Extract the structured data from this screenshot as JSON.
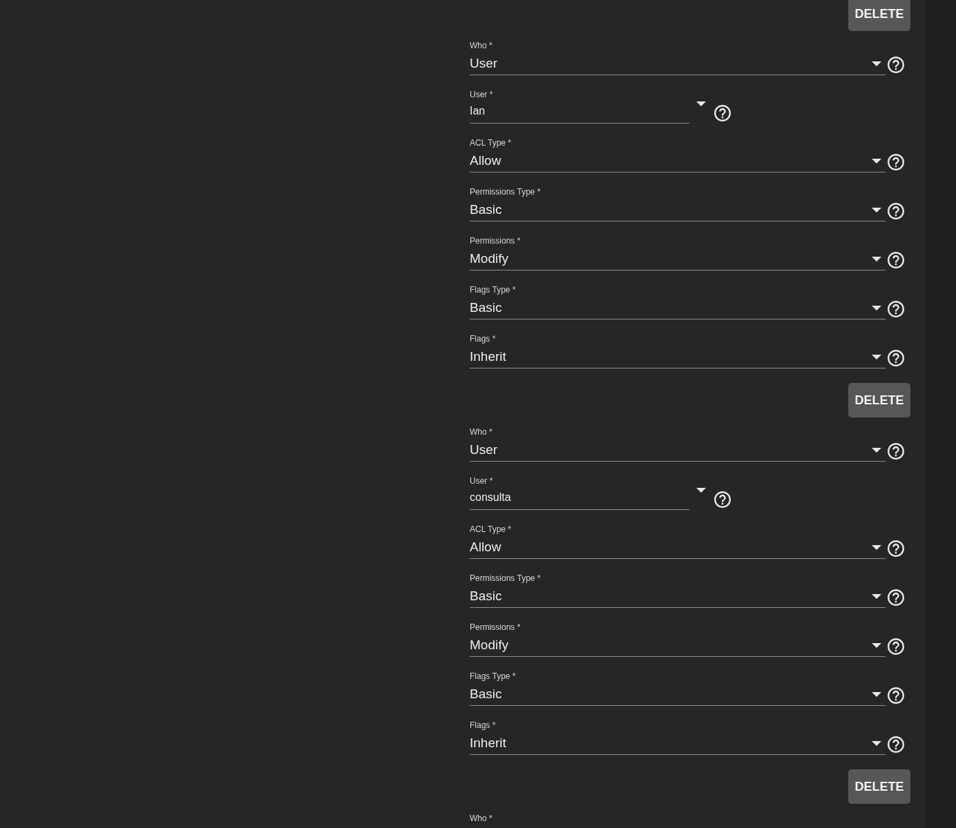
{
  "acl_entries": [
    {
      "delete_button": "DELETE"
    },
    {
      "fields": [
        {
          "label": "Who *",
          "kind": "select",
          "value": "User"
        },
        {
          "label": "User *",
          "kind": "combobox",
          "value": "Ian"
        },
        {
          "label": "ACL Type *",
          "kind": "select",
          "value": "Allow"
        },
        {
          "label": "Permissions Type *",
          "kind": "select",
          "value": "Basic"
        },
        {
          "label": "Permissions *",
          "kind": "select",
          "value": "Modify"
        },
        {
          "label": "Flags Type *",
          "kind": "select",
          "value": "Basic"
        },
        {
          "label": "Flags *",
          "kind": "select",
          "value": "Inherit"
        }
      ],
      "delete_button": "DELETE"
    },
    {
      "fields": [
        {
          "label": "Who *",
          "kind": "select",
          "value": "User"
        },
        {
          "label": "User *",
          "kind": "combobox",
          "value": "consulta"
        },
        {
          "label": "ACL Type *",
          "kind": "select",
          "value": "Allow"
        },
        {
          "label": "Permissions Type *",
          "kind": "select",
          "value": "Basic"
        },
        {
          "label": "Permissions *",
          "kind": "select",
          "value": "Modify"
        },
        {
          "label": "Flags Type *",
          "kind": "select",
          "value": "Basic"
        },
        {
          "label": "Flags *",
          "kind": "select",
          "value": "Inherit"
        }
      ],
      "delete_button": "DELETE"
    },
    {
      "fields": [
        {
          "label": "Who *"
        }
      ]
    }
  ]
}
